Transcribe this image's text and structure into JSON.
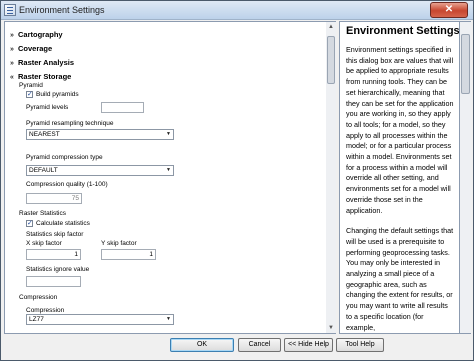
{
  "window": {
    "title": "Environment Settings",
    "close_glyph": "✕"
  },
  "sections": {
    "cartography": "Cartography",
    "coverage": "Coverage",
    "raster_analysis": "Raster Analysis",
    "raster_storage": "Raster Storage"
  },
  "pyramid": {
    "group_label": "Pyramid",
    "build_pyramids_label": "Build pyramids",
    "build_pyramids_checked": true,
    "levels_label": "Pyramid levels",
    "levels_value": "",
    "resampling_label": "Pyramid resampling technique",
    "resampling_value": "NEAREST",
    "compression_label": "Pyramid compression type",
    "compression_value": "DEFAULT",
    "quality_label": "Compression quality (1-100)",
    "quality_value": "75"
  },
  "raster_statistics": {
    "group_label": "Raster Statistics",
    "calculate_label": "Calculate statistics",
    "calculate_checked": true,
    "skip_factor_label": "Statistics skip factor",
    "x_skip_label": "X skip factor",
    "x_skip_value": "1",
    "y_skip_label": "Y skip factor",
    "y_skip_value": "1",
    "ignore_label": "Statistics ignore value",
    "ignore_value": ""
  },
  "compression": {
    "group_label": "Compression",
    "field_label": "Compression",
    "value": "LZ77"
  },
  "help": {
    "title": "Environment Settings",
    "paragraphs": [
      "Environment settings specified in this dialog box are values that will be applied to appropriate results from running tools. They can be set hierarchically, meaning that they can be set for the application you are working in, so they apply to all tools; for a model, so they apply to all processes within the model; or for a particular process within a model. Environments set for a process within a model will override all other setting, and environments set for a model will override those set in the application.",
      "Changing the default settings that will be used is a prerequisite to performing geoprocessing tasks. You may only be interested in analyzing a small piece of a geographic area, such as changing the extent for results, or you may want to write all results to a specific location (for example,"
    ]
  },
  "buttons": {
    "ok": "OK",
    "cancel": "Cancel",
    "hide_help": "<< Hide Help",
    "tool_help": "Tool Help"
  },
  "icons": {
    "section_expand": "double-chevron-icon",
    "dropdown": "triangle-down-icon"
  },
  "colors": {
    "title_gradient_top": "#dfe9f5",
    "close_button": "#c7462f",
    "check_mark": "#234c9c"
  }
}
